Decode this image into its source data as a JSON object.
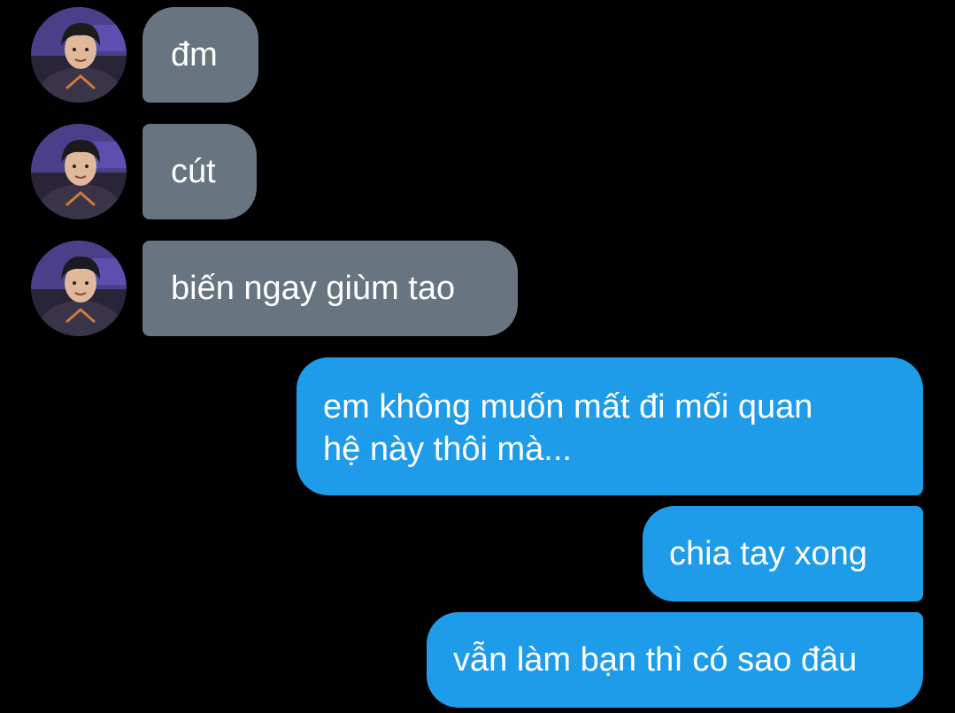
{
  "conversation": {
    "incoming": [
      {
        "text": "đm",
        "avatar_icon": "user-avatar-icon"
      },
      {
        "text": "cút",
        "avatar_icon": "user-avatar-icon"
      },
      {
        "text": "biến ngay giùm tao",
        "avatar_icon": "user-avatar-icon"
      }
    ],
    "outgoing": [
      {
        "line1": "em không muốn mất đi mối quan",
        "line2": "hệ này thôi mà..."
      },
      {
        "text": "chia tay xong"
      },
      {
        "text": "vẫn làm bạn thì có sao đâu"
      }
    ]
  },
  "colors": {
    "background": "#000000",
    "incoming_bubble": "#687480",
    "outgoing_bubble": "#1f9ce9",
    "text": "#ffffff"
  }
}
